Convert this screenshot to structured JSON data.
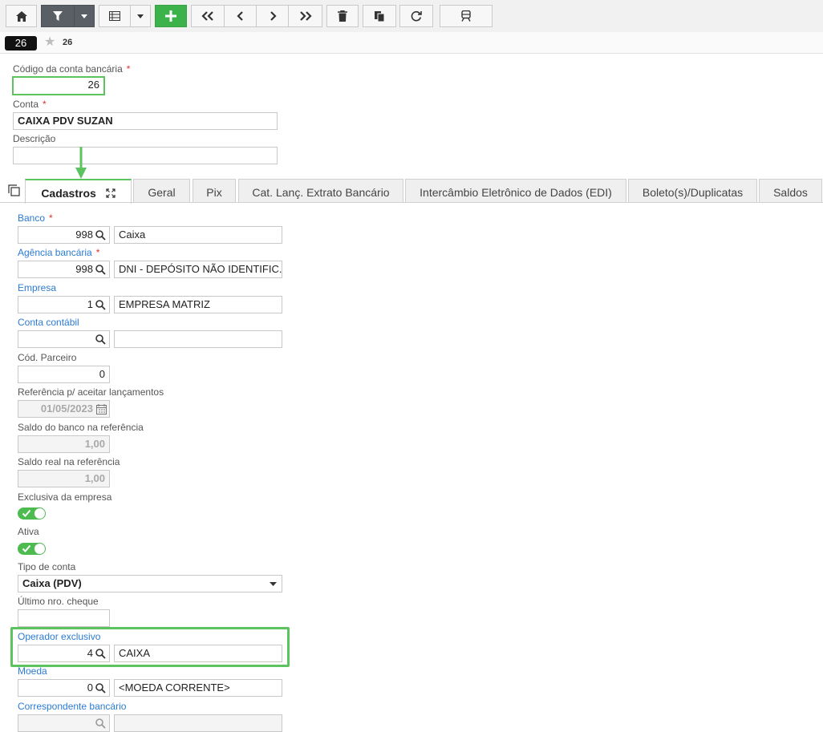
{
  "record": {
    "id_badge": "26",
    "favorite_count": "26"
  },
  "header_fields": {
    "codigo": {
      "label": "Código da conta bancária",
      "required": "*",
      "value": "26"
    },
    "conta": {
      "label": "Conta",
      "required": "*",
      "value": "CAIXA PDV SUZAN"
    },
    "descricao": {
      "label": "Descrição",
      "value": ""
    }
  },
  "tabs": [
    {
      "label": "Cadastros",
      "active": true
    },
    {
      "label": "Geral"
    },
    {
      "label": "Pix"
    },
    {
      "label": "Cat. Lanç. Extrato Bancário"
    },
    {
      "label": "Intercâmbio Eletrônico de Dados (EDI)"
    },
    {
      "label": "Boleto(s)/Duplicatas"
    },
    {
      "label": "Saldos"
    }
  ],
  "form": {
    "banco": {
      "label": "Banco",
      "required": "*",
      "code": "998",
      "name": "Caixa"
    },
    "agencia": {
      "label": "Agência bancária",
      "required": "*",
      "code": "998",
      "name": "DNI - DEPÓSITO NÃO IDENTIFIC."
    },
    "empresa": {
      "label": "Empresa",
      "code": "1",
      "name": "EMPRESA MATRIZ"
    },
    "conta_contabil": {
      "label": "Conta contábil",
      "code": "",
      "name": ""
    },
    "cod_parceiro": {
      "label": "Cód. Parceiro",
      "value": "0"
    },
    "referencia": {
      "label": "Referência p/ aceitar lançamentos",
      "value": "01/05/2023"
    },
    "saldo_banco": {
      "label": "Saldo do banco na referência",
      "value": "1,00"
    },
    "saldo_real": {
      "label": "Saldo real na referência",
      "value": "1,00"
    },
    "exclusiva": {
      "label": "Exclusiva da empresa",
      "on": true
    },
    "ativa": {
      "label": "Ativa",
      "on": true
    },
    "tipo_conta": {
      "label": "Tipo de conta",
      "value": "Caixa (PDV)"
    },
    "ultimo_cheque": {
      "label": "Último nro. cheque",
      "value": ""
    },
    "operador": {
      "label": "Operador exclusivo",
      "code": "4",
      "name": "CAIXA"
    },
    "moeda": {
      "label": "Moeda",
      "code": "0",
      "name": "<MOEDA CORRENTE>"
    },
    "correspondente": {
      "label": "Correspondente bancário",
      "code": "",
      "name": ""
    }
  },
  "colors": {
    "accent_green": "#5cc35e",
    "link_blue": "#2b7bd3",
    "required_red": "#e0312f",
    "toolbar_dark": "#5a5f66"
  }
}
